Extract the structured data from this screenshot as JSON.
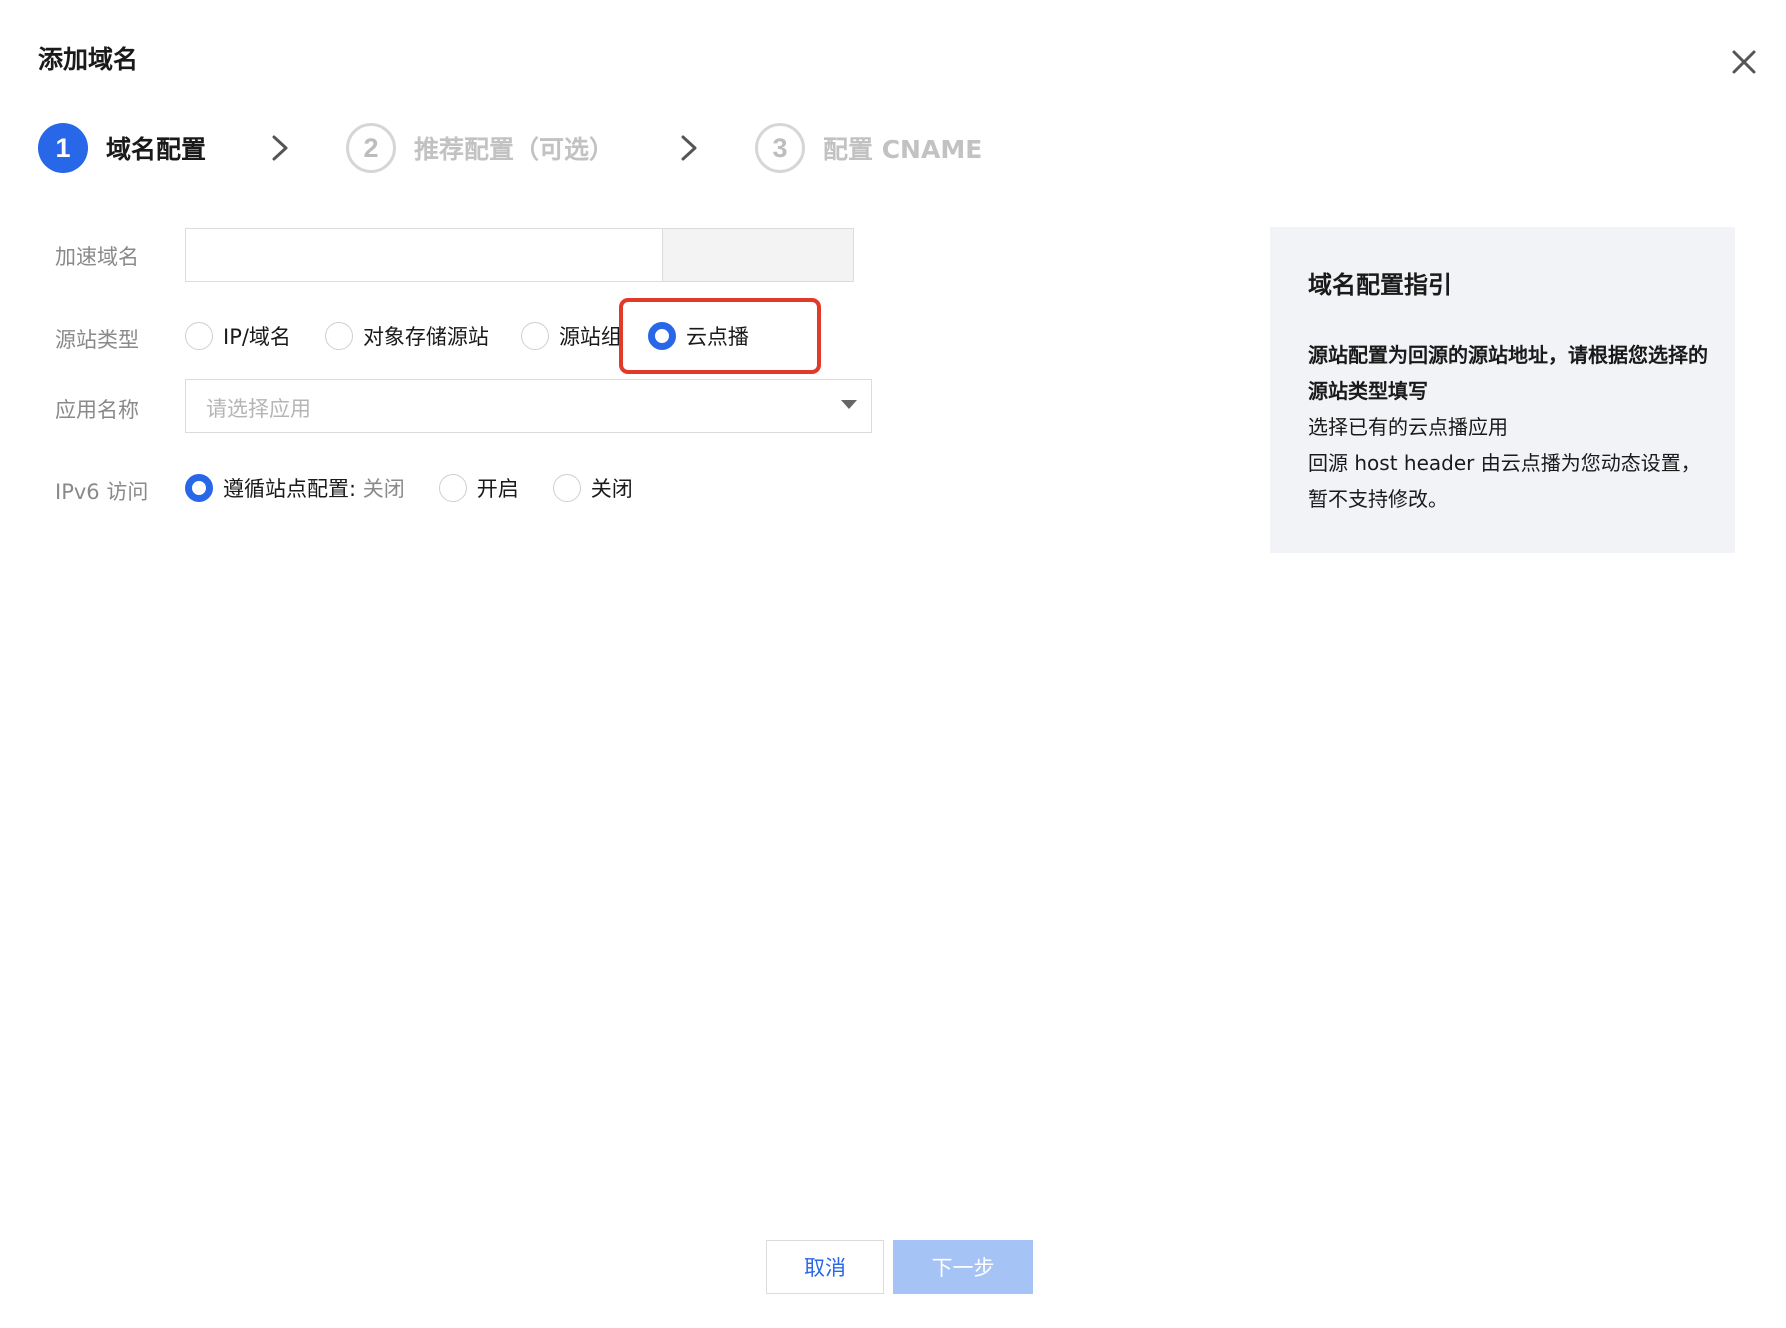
{
  "dialog": {
    "title": "添加域名"
  },
  "steps": [
    {
      "number": "1",
      "label": "域名配置",
      "state": "active"
    },
    {
      "number": "2",
      "label": "推荐配置（可选）",
      "state": "inactive"
    },
    {
      "number": "3",
      "label": "配置 CNAME",
      "state": "inactive"
    }
  ],
  "form": {
    "domain": {
      "label": "加速域名",
      "value": ""
    },
    "origin_type": {
      "label": "源站类型",
      "options": [
        "IP/域名",
        "对象存储源站",
        "源站组",
        "云点播"
      ],
      "selected": "云点播"
    },
    "app_name": {
      "label": "应用名称",
      "placeholder": "请选择应用"
    },
    "ipv6": {
      "label": "IPv6 访问",
      "option1_prefix": "遵循站点配置:",
      "option1_suffix": " 关闭",
      "option2": "开启",
      "option3": "关闭",
      "selected": "遵循站点配置"
    }
  },
  "guide": {
    "title": "域名配置指引",
    "bold_text": "源站配置为回源的源站地址，请根据您选择的源站类型填写",
    "line2": "选择已有的云点播应用",
    "line3": "回源 host header 由云点播为您动态设置，暂不支持修改。"
  },
  "footer": {
    "cancel_label": "取消",
    "next_label": "下一步"
  },
  "colors": {
    "primary": "#2767e8",
    "highlight": "#e23a2a",
    "next_disabled": "#a6c3f5"
  }
}
